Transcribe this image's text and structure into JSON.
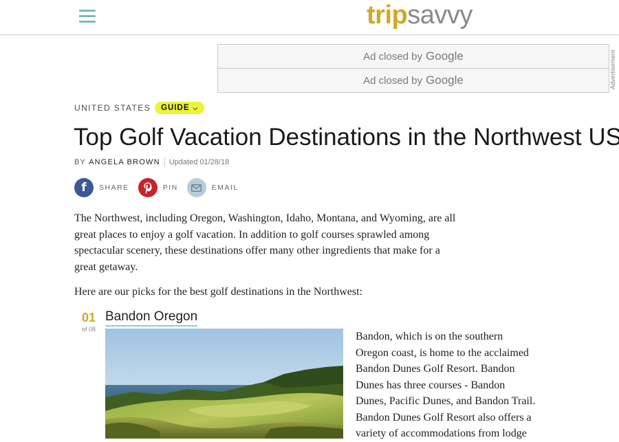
{
  "header": {
    "logo_part1": "trip",
    "logo_part2": "savvy"
  },
  "ads": {
    "ad1_text": "Ad closed by",
    "ad1_brand": "Google",
    "ad2_text": "Ad closed by",
    "ad2_brand": "Google",
    "side_label": "Advertisement"
  },
  "breadcrumb": {
    "category": "UNITED STATES",
    "pill": "GUIDE",
    "pill_icon": "chevron-down-icon"
  },
  "article": {
    "title": "Top Golf Vacation Destinations in the Northwest US",
    "by": "BY",
    "author": "ANGELA BROWN",
    "updated": "Updated 01/28/18",
    "intro": "The Northwest, including Oregon, Washington, Idaho, Montana, and Wyoming, are all great places to enjoy a golf vacation. In addition to golf courses sprawled among spectacular scenery, these destinations offer many other ingredients that make for a great getaway.",
    "picks_intro": "Here are our picks for the best golf destinations in the Northwest:"
  },
  "social": {
    "share": "SHARE",
    "pin": "PIN",
    "email": "EMAIL"
  },
  "list_item": {
    "number": "01",
    "of": "of 08",
    "title": "Bandon Oregon",
    "text": "Bandon, which is on the southern Oregon coast, is home to the acclaimed Bandon Dunes Golf Resort. Bandon Dunes has three courses - Bandon Dunes, Pacific Dunes, and Bandon Trail. Bandon Dunes Golf Resort also offers a variety of accommodations from lodge"
  },
  "colors": {
    "accent_gold": "#d1a828",
    "hamburger_teal": "#7cb9b8",
    "guide_yellow": "#e9f536",
    "facebook": "#3b5897",
    "pinterest": "#c8232c",
    "email": "#b9cdd8",
    "title_underline": "#8ccfd8"
  }
}
